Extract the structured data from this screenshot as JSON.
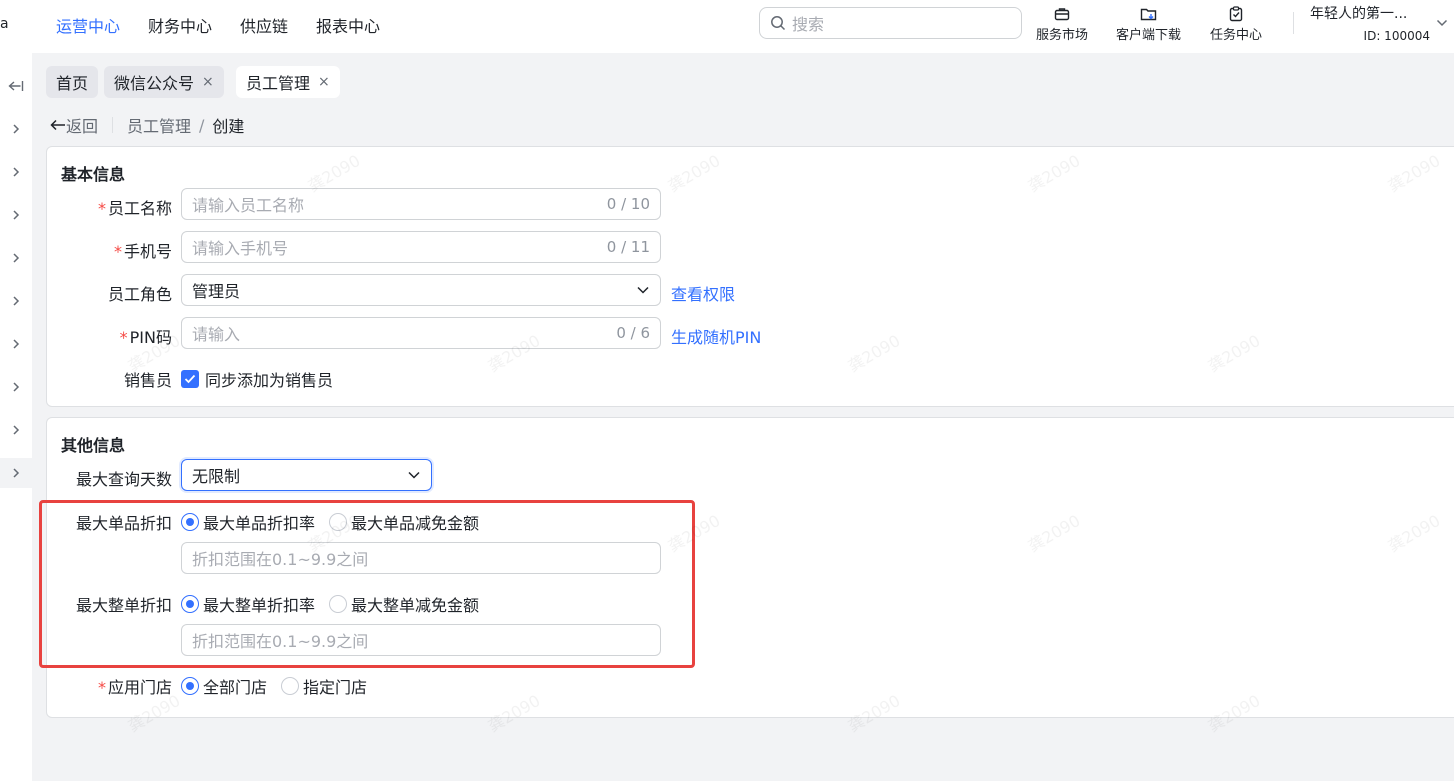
{
  "top_edge_text": "a",
  "nav": [
    "运营中心",
    "财务中心",
    "供应链",
    "报表中心"
  ],
  "search": {
    "placeholder": "搜索"
  },
  "tools": [
    {
      "label": "服务市场",
      "icon": "briefcase-icon"
    },
    {
      "label": "客户端下载",
      "icon": "folder-download-icon"
    },
    {
      "label": "任务中心",
      "icon": "clipboard-check-icon"
    }
  ],
  "user": {
    "name": "年轻人的第一...",
    "id": "ID: 100004"
  },
  "tabs": [
    {
      "label": "首页"
    },
    {
      "label": "微信公众号",
      "close": "×"
    },
    {
      "label": "员工管理",
      "close": "×"
    }
  ],
  "breadcrumb": {
    "back": "返回",
    "parent": "员工管理",
    "sep": "/",
    "current": "创建"
  },
  "basic": {
    "title": "基本信息",
    "name_label": "员工名称",
    "name_ph": "请输入员工名称",
    "name_cnt": "0 / 10",
    "phone_label": "手机号",
    "phone_ph": "请输入手机号",
    "phone_cnt": "0 / 11",
    "role_label": "员工角色",
    "role_value": "管理员",
    "role_link": "查看权限",
    "pin_label": "PIN码",
    "pin_ph": "请输入",
    "pin_cnt": "0 / 6",
    "pin_link": "生成随机PIN",
    "sales_label": "销售员",
    "sales_check": "同步添加为销售员"
  },
  "other": {
    "title": "其他信息",
    "days_label": "最大查询天数",
    "days_value": "无限制",
    "item_label": "最大单品折扣",
    "item_opt1": "最大单品折扣率",
    "item_opt2": "最大单品减免金额",
    "item_ph": "折扣范围在0.1~9.9之间",
    "order_label": "最大整单折扣",
    "order_opt1": "最大整单折扣率",
    "order_opt2": "最大整单减免金额",
    "order_ph": "折扣范围在0.1~9.9之间",
    "store_label": "应用门店",
    "store_opt1": "全部门店",
    "store_opt2": "指定门店"
  },
  "required_mark": "*",
  "watermark": "龚2090",
  "colors": {
    "accent": "#3370ff",
    "required": "#f54a45",
    "highlight": "#e8423f"
  }
}
